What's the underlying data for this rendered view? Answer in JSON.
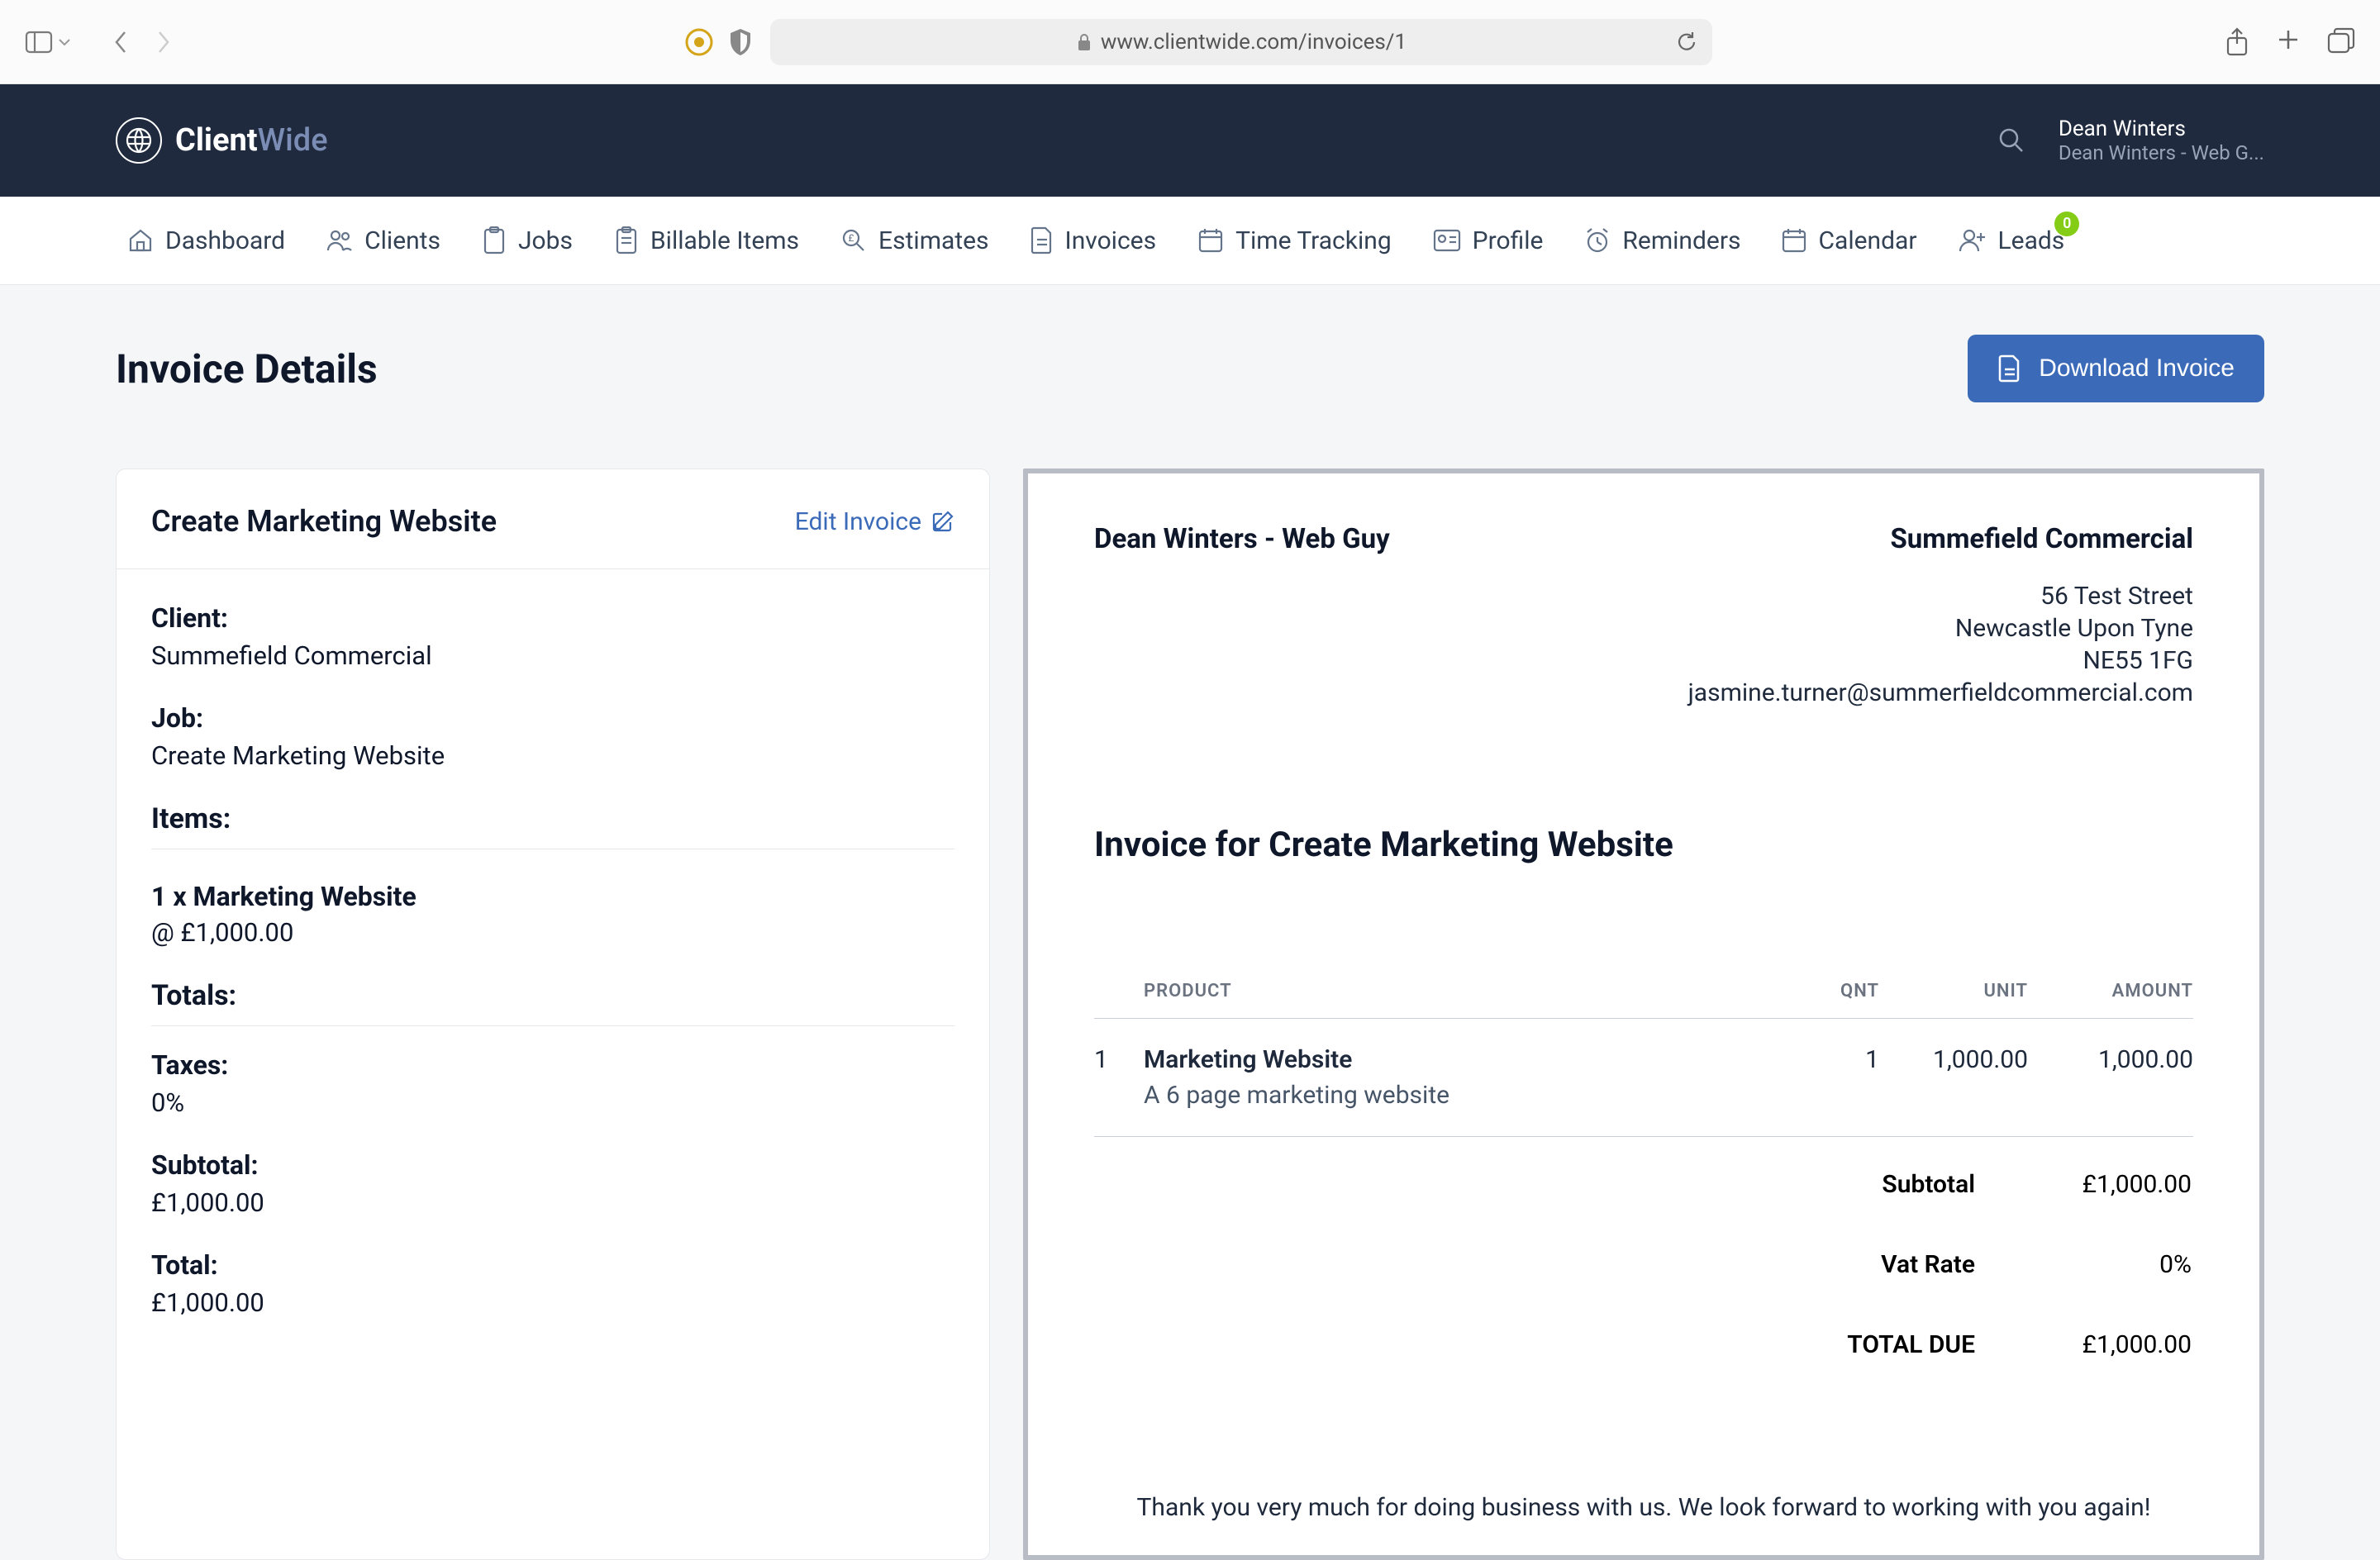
{
  "browser": {
    "url": "www.clientwide.com/invoices/1"
  },
  "brand": {
    "part1": "Client",
    "part2": "Wide"
  },
  "header": {
    "user_name": "Dean Winters",
    "user_sub": "Dean Winters - Web G..."
  },
  "nav": {
    "items": [
      {
        "label": "Dashboard"
      },
      {
        "label": "Clients"
      },
      {
        "label": "Jobs"
      },
      {
        "label": "Billable Items"
      },
      {
        "label": "Estimates"
      },
      {
        "label": "Invoices"
      },
      {
        "label": "Time Tracking"
      },
      {
        "label": "Profile"
      },
      {
        "label": "Reminders"
      },
      {
        "label": "Calendar"
      },
      {
        "label": "Leads",
        "badge": "0"
      }
    ]
  },
  "page": {
    "title": "Invoice Details",
    "download_label": "Download Invoice"
  },
  "card": {
    "title": "Create Marketing Website",
    "edit_label": "Edit Invoice",
    "client_label": "Client:",
    "client_value": "Summefield Commercial",
    "job_label": "Job:",
    "job_value": "Create Marketing Website",
    "items_label": "Items:",
    "item_line1": "1 x Marketing Website",
    "item_line2": "@ £1,000.00",
    "totals_label": "Totals:",
    "taxes_label": "Taxes:",
    "taxes_value": "0%",
    "subtotal_label": "Subtotal:",
    "subtotal_value": "£1,000.00",
    "total_label": "Total:",
    "total_value": "£1,000.00"
  },
  "invoice": {
    "from": "Dean Winters - Web Guy",
    "to_name": "Summefield Commercial",
    "addr1": "56 Test Street",
    "addr2": "Newcastle Upon Tyne",
    "addr3": "NE55 1FG",
    "email": "jasmine.turner@summerfieldcommercial.com",
    "title": "Invoice for Create Marketing Website",
    "cols": {
      "product": "PRODUCT",
      "qnt": "QNT",
      "unit": "UNIT",
      "amount": "AMOUNT"
    },
    "rows": [
      {
        "n": "1",
        "name": "Marketing Website",
        "desc": "A 6 page marketing website",
        "qnt": "1",
        "unit": "1,000.00",
        "amount": "1,000.00"
      }
    ],
    "subtotal_label": "Subtotal",
    "subtotal_value": "£1,000.00",
    "vat_label": "Vat Rate",
    "vat_value": "0%",
    "due_label": "TOTAL DUE",
    "due_value": "£1,000.00",
    "thanks": "Thank you very much for doing business with us. We look forward to working with you again!"
  }
}
